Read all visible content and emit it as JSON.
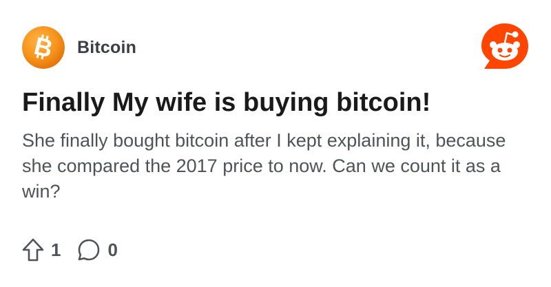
{
  "community": {
    "name": "Bitcoin",
    "avatar_icon": "bitcoin-logo-icon",
    "avatar_color": "#f7931a"
  },
  "brand": {
    "logo_icon": "reddit-logo-icon",
    "color": "#ff4500"
  },
  "post": {
    "title": "Finally My wife is buying bitcoin!",
    "body": "She finally bought bitcoin after I kept explaining it, because she compared the 2017 price to now. Can we count it as a win?"
  },
  "actions": {
    "upvote_icon": "upvote-arrow-icon",
    "upvotes": "1",
    "comment_icon": "comment-bubble-icon",
    "comments": "0"
  }
}
